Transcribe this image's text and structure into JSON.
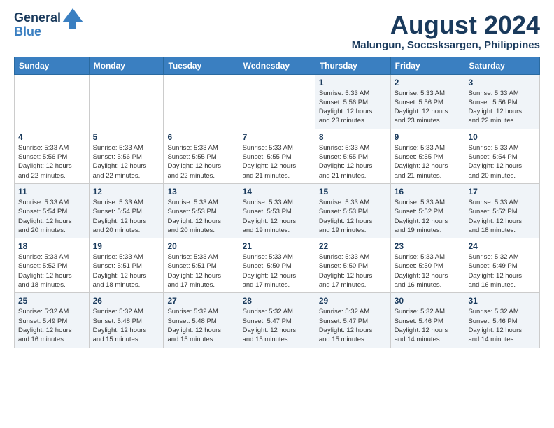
{
  "header": {
    "logo_line1": "General",
    "logo_line2": "Blue",
    "main_title": "August 2024",
    "subtitle": "Malungun, Soccsksargen, Philippines"
  },
  "weekdays": [
    "Sunday",
    "Monday",
    "Tuesday",
    "Wednesday",
    "Thursday",
    "Friday",
    "Saturday"
  ],
  "weeks": [
    [
      {
        "day": "",
        "info": ""
      },
      {
        "day": "",
        "info": ""
      },
      {
        "day": "",
        "info": ""
      },
      {
        "day": "",
        "info": ""
      },
      {
        "day": "1",
        "info": "Sunrise: 5:33 AM\nSunset: 5:56 PM\nDaylight: 12 hours\nand 23 minutes."
      },
      {
        "day": "2",
        "info": "Sunrise: 5:33 AM\nSunset: 5:56 PM\nDaylight: 12 hours\nand 23 minutes."
      },
      {
        "day": "3",
        "info": "Sunrise: 5:33 AM\nSunset: 5:56 PM\nDaylight: 12 hours\nand 22 minutes."
      }
    ],
    [
      {
        "day": "4",
        "info": "Sunrise: 5:33 AM\nSunset: 5:56 PM\nDaylight: 12 hours\nand 22 minutes."
      },
      {
        "day": "5",
        "info": "Sunrise: 5:33 AM\nSunset: 5:56 PM\nDaylight: 12 hours\nand 22 minutes."
      },
      {
        "day": "6",
        "info": "Sunrise: 5:33 AM\nSunset: 5:55 PM\nDaylight: 12 hours\nand 22 minutes."
      },
      {
        "day": "7",
        "info": "Sunrise: 5:33 AM\nSunset: 5:55 PM\nDaylight: 12 hours\nand 21 minutes."
      },
      {
        "day": "8",
        "info": "Sunrise: 5:33 AM\nSunset: 5:55 PM\nDaylight: 12 hours\nand 21 minutes."
      },
      {
        "day": "9",
        "info": "Sunrise: 5:33 AM\nSunset: 5:55 PM\nDaylight: 12 hours\nand 21 minutes."
      },
      {
        "day": "10",
        "info": "Sunrise: 5:33 AM\nSunset: 5:54 PM\nDaylight: 12 hours\nand 20 minutes."
      }
    ],
    [
      {
        "day": "11",
        "info": "Sunrise: 5:33 AM\nSunset: 5:54 PM\nDaylight: 12 hours\nand 20 minutes."
      },
      {
        "day": "12",
        "info": "Sunrise: 5:33 AM\nSunset: 5:54 PM\nDaylight: 12 hours\nand 20 minutes."
      },
      {
        "day": "13",
        "info": "Sunrise: 5:33 AM\nSunset: 5:53 PM\nDaylight: 12 hours\nand 20 minutes."
      },
      {
        "day": "14",
        "info": "Sunrise: 5:33 AM\nSunset: 5:53 PM\nDaylight: 12 hours\nand 19 minutes."
      },
      {
        "day": "15",
        "info": "Sunrise: 5:33 AM\nSunset: 5:53 PM\nDaylight: 12 hours\nand 19 minutes."
      },
      {
        "day": "16",
        "info": "Sunrise: 5:33 AM\nSunset: 5:52 PM\nDaylight: 12 hours\nand 19 minutes."
      },
      {
        "day": "17",
        "info": "Sunrise: 5:33 AM\nSunset: 5:52 PM\nDaylight: 12 hours\nand 18 minutes."
      }
    ],
    [
      {
        "day": "18",
        "info": "Sunrise: 5:33 AM\nSunset: 5:52 PM\nDaylight: 12 hours\nand 18 minutes."
      },
      {
        "day": "19",
        "info": "Sunrise: 5:33 AM\nSunset: 5:51 PM\nDaylight: 12 hours\nand 18 minutes."
      },
      {
        "day": "20",
        "info": "Sunrise: 5:33 AM\nSunset: 5:51 PM\nDaylight: 12 hours\nand 17 minutes."
      },
      {
        "day": "21",
        "info": "Sunrise: 5:33 AM\nSunset: 5:50 PM\nDaylight: 12 hours\nand 17 minutes."
      },
      {
        "day": "22",
        "info": "Sunrise: 5:33 AM\nSunset: 5:50 PM\nDaylight: 12 hours\nand 17 minutes."
      },
      {
        "day": "23",
        "info": "Sunrise: 5:33 AM\nSunset: 5:50 PM\nDaylight: 12 hours\nand 16 minutes."
      },
      {
        "day": "24",
        "info": "Sunrise: 5:32 AM\nSunset: 5:49 PM\nDaylight: 12 hours\nand 16 minutes."
      }
    ],
    [
      {
        "day": "25",
        "info": "Sunrise: 5:32 AM\nSunset: 5:49 PM\nDaylight: 12 hours\nand 16 minutes."
      },
      {
        "day": "26",
        "info": "Sunrise: 5:32 AM\nSunset: 5:48 PM\nDaylight: 12 hours\nand 15 minutes."
      },
      {
        "day": "27",
        "info": "Sunrise: 5:32 AM\nSunset: 5:48 PM\nDaylight: 12 hours\nand 15 minutes."
      },
      {
        "day": "28",
        "info": "Sunrise: 5:32 AM\nSunset: 5:47 PM\nDaylight: 12 hours\nand 15 minutes."
      },
      {
        "day": "29",
        "info": "Sunrise: 5:32 AM\nSunset: 5:47 PM\nDaylight: 12 hours\nand 15 minutes."
      },
      {
        "day": "30",
        "info": "Sunrise: 5:32 AM\nSunset: 5:46 PM\nDaylight: 12 hours\nand 14 minutes."
      },
      {
        "day": "31",
        "info": "Sunrise: 5:32 AM\nSunset: 5:46 PM\nDaylight: 12 hours\nand 14 minutes."
      }
    ]
  ]
}
